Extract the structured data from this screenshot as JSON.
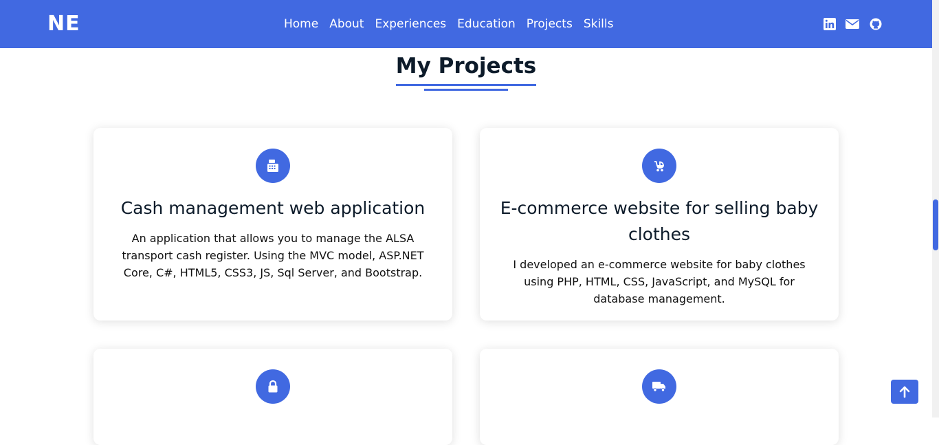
{
  "brand": "NE",
  "nav": {
    "links": [
      "Home",
      "About",
      "Experiences",
      "Education",
      "Projects",
      "Skills"
    ]
  },
  "social": [
    "linkedin-icon",
    "email-icon",
    "github-icon"
  ],
  "section": {
    "title": "My Projects"
  },
  "projects": [
    {
      "icon": "cash-register-icon",
      "title": "Cash management web application",
      "description": "An application that allows you to manage the ALSA transport cash register. Using the MVC model, ASP.NET Core, C#, HTML5, CSS3, JS, Sql Server, and Bootstrap."
    },
    {
      "icon": "baby-carriage-icon",
      "title": "E-commerce website for selling baby clothes",
      "description": "I developed an e-commerce website for baby clothes using PHP, HTML, CSS, JavaScript, and MySQL for database management."
    },
    {
      "icon": "lock-icon",
      "title": "",
      "description": ""
    },
    {
      "icon": "truck-icon",
      "title": "",
      "description": ""
    }
  ],
  "colors": {
    "accent": "#4169e1",
    "text": "#0d1b2a"
  }
}
